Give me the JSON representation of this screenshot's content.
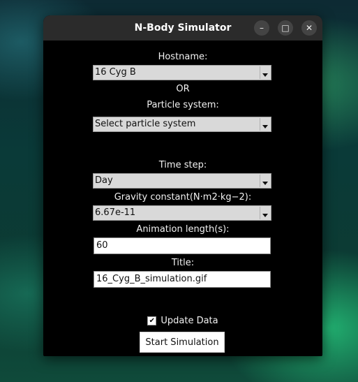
{
  "window": {
    "title": "N-Body Simulator",
    "controls": {
      "minimize": "–",
      "maximize": "□",
      "close": "✕"
    }
  },
  "form": {
    "hostname_label": "Hostname:",
    "hostname_value": "16 Cyg B",
    "or_label": "OR",
    "particle_label": "Particle system:",
    "particle_value": "Select particle system",
    "timestep_label": "Time step:",
    "timestep_value": "Day",
    "gravity_label": "Gravity constant(N·m2·kg−2):",
    "gravity_value": "6.67e-11",
    "animation_label": "Animation length(s):",
    "animation_value": "60",
    "title_label": "Title:",
    "title_value": "16_Cyg_B_simulation.gif",
    "update_label": "Update Data",
    "update_checked": true,
    "start_button": "Start Simulation"
  }
}
